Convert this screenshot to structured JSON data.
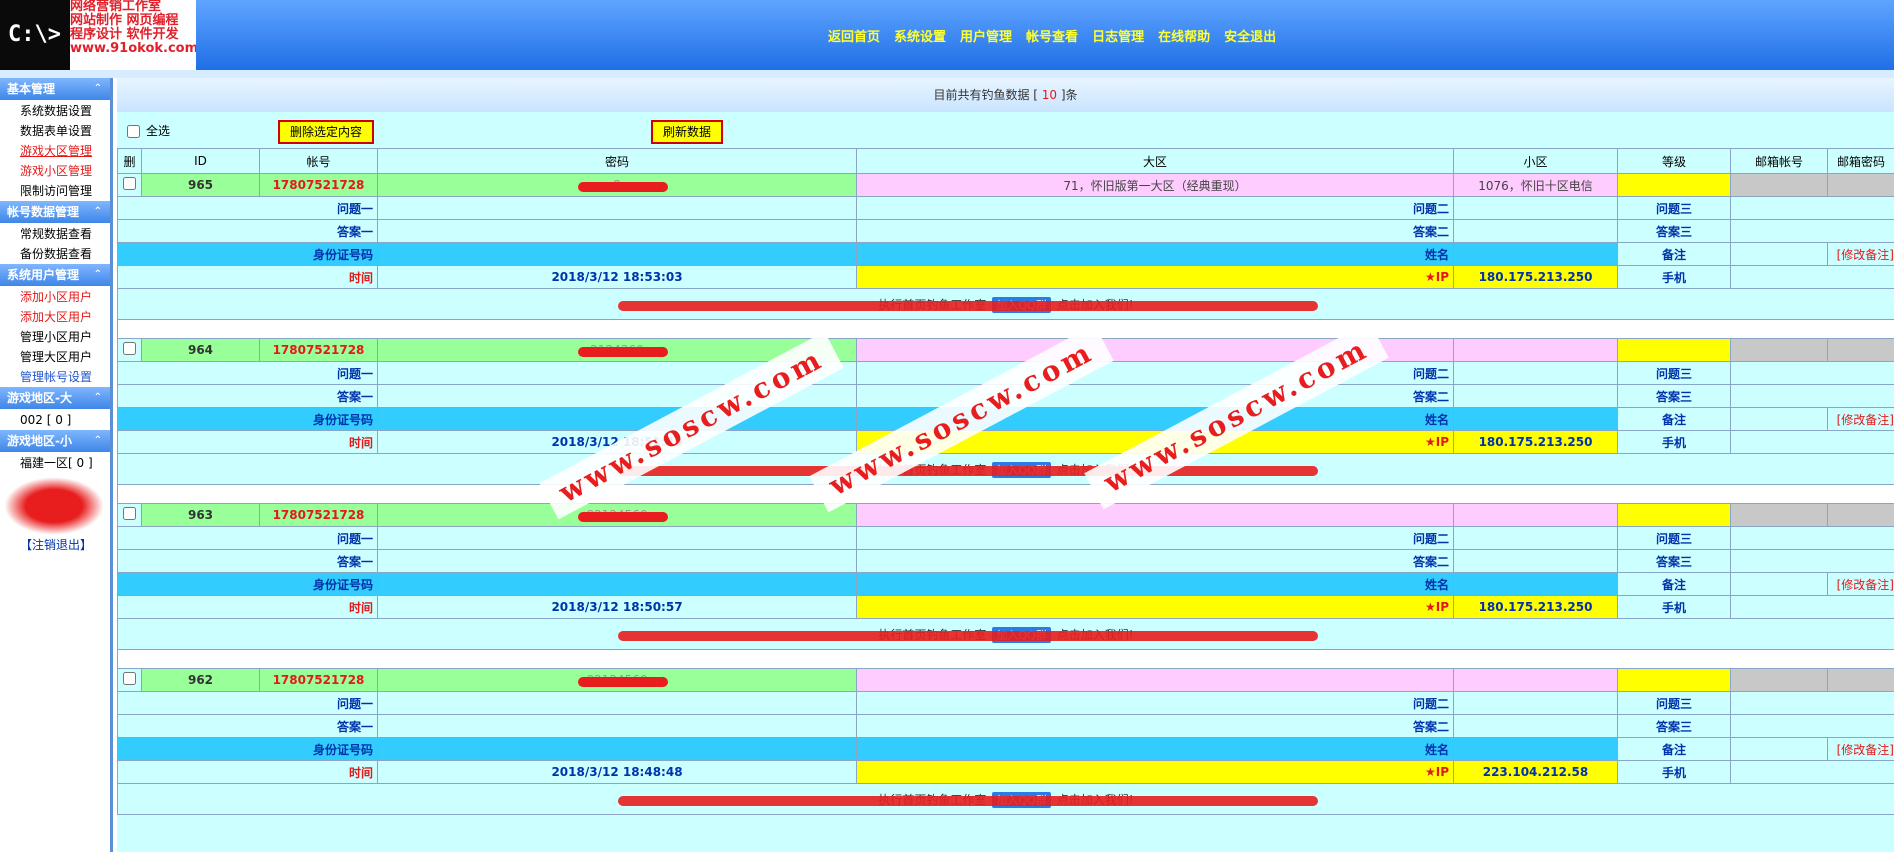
{
  "logo": {
    "text": "C:\\>",
    "lines": [
      "网络营销工作室",
      "网站制作 网页编程",
      "程序设计 软件开发"
    ],
    "url": "www.91okok.com"
  },
  "topnav": [
    "返回首页",
    "系统设置",
    "用户管理",
    "帐号查看",
    "日志管理",
    "在线帮助",
    "安全退出"
  ],
  "sidebar": {
    "sections": [
      {
        "title": "基本管理",
        "items": [
          {
            "label": "系统数据设置",
            "style": ""
          },
          {
            "label": "数据表单设置",
            "style": ""
          },
          {
            "label": "游戏大区管理",
            "style": "red uline"
          },
          {
            "label": "游戏小区管理",
            "style": "red"
          },
          {
            "label": "限制访问管理",
            "style": ""
          }
        ]
      },
      {
        "title": "帐号数据管理",
        "items": [
          {
            "label": "常规数据查看",
            "style": ""
          },
          {
            "label": "备份数据查看",
            "style": ""
          }
        ]
      },
      {
        "title": "系统用户管理",
        "items": [
          {
            "label": "添加小区用户",
            "style": "red"
          },
          {
            "label": "添加大区用户",
            "style": "red"
          },
          {
            "label": "管理小区用户",
            "style": ""
          },
          {
            "label": "管理大区用户",
            "style": ""
          },
          {
            "label": "管理帐号设置",
            "style": "blue"
          }
        ]
      },
      {
        "title": "游戏地区-大",
        "items": [
          {
            "label": "002 [ 0 ]",
            "style": ""
          }
        ]
      },
      {
        "title": "游戏地区-小",
        "items": [
          {
            "label": "福建一区[ 0 ]",
            "style": ""
          }
        ]
      }
    ],
    "logout": "【注销退出】"
  },
  "main": {
    "counter_prefix": "目前共有钓鱼数据 [ ",
    "counter_value": "10",
    "counter_suffix": " ]条",
    "select_all": "全选",
    "delete_button": "删除选定内容",
    "refresh_button": "刷新数据"
  },
  "headers": [
    "删",
    "ID",
    "帐号",
    "密码",
    "大区",
    "小区",
    "等级",
    "邮箱帐号",
    "邮箱密码"
  ],
  "labels": {
    "q1": "问题一",
    "a1": "答案一",
    "q2": "问题二",
    "a2": "答案二",
    "q3": "问题三",
    "a3": "答案三",
    "idcard": "身份证号码",
    "name": "姓名",
    "note": "备注",
    "edit_note": "[修改备注]",
    "time": "时间",
    "ip": "IP",
    "phone": "手机",
    "qq": "加入QQ群",
    "msg_end": "点击加入我们!"
  },
  "records": [
    {
      "id": "965",
      "account": "17807521728",
      "password_visible": "8",
      "big_zone": "71，怀旧版第一大区（经典重现）",
      "small_zone": "1076，怀旧十区电信",
      "time": "2018/3/12 18:53:03",
      "ip": "180.175.213.250",
      "msg": "执行首页钓鱼工作室"
    },
    {
      "id": "964",
      "account": "17807521728",
      "password_visible": "2124360",
      "big_zone": "",
      "small_zone": "",
      "time": "2018/3/12 18:51:40",
      "ip": "180.175.213.250",
      "msg": "执行首页钓鱼工作室"
    },
    {
      "id": "963",
      "account": "17807521728",
      "password_visible": "82124560",
      "big_zone": "",
      "small_zone": "",
      "time": "2018/3/12 18:50:57",
      "ip": "180.175.213.250",
      "msg": "执行首页钓鱼工作室"
    },
    {
      "id": "962",
      "account": "17807521728",
      "password_visible": "82124560",
      "big_zone": "",
      "small_zone": "",
      "time": "2018/3/12 18:48:48",
      "ip": "223.104.212.58",
      "msg": "执行首页钓鱼工作室"
    }
  ],
  "watermark": "www.soscw.com",
  "colors": {
    "topbar": "#1f6fe6",
    "nav_text": "#ffff33",
    "main_bg": "#ccffff",
    "account_red": "#e31a1a",
    "label_blue": "#0033aa",
    "green_cell": "#99ff99",
    "pink_cell": "#ffccff",
    "yellow_cell": "#ffff00",
    "blue_row": "#33ccff"
  }
}
